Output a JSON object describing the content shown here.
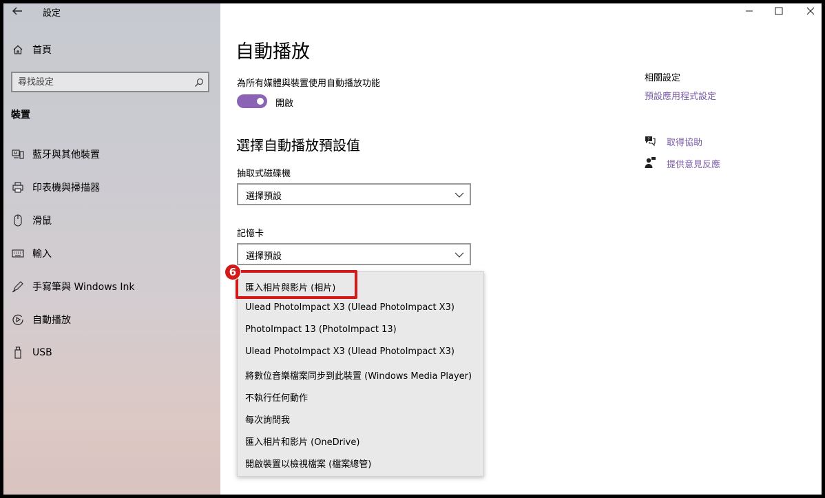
{
  "window": {
    "title": "設定",
    "controls": [
      "minimize-icon",
      "maximize-icon",
      "close-icon"
    ]
  },
  "sidebar": {
    "home_label": "首頁",
    "search_placeholder": "尋找設定",
    "section_header": "裝置",
    "items": [
      {
        "label": "藍牙與其他裝置",
        "icon": "bluetooth-devices-icon"
      },
      {
        "label": "印表機與掃描器",
        "icon": "printer-icon"
      },
      {
        "label": "滑鼠",
        "icon": "mouse-icon"
      },
      {
        "label": "輸入",
        "icon": "keyboard-icon"
      },
      {
        "label": "手寫筆與 Windows Ink",
        "icon": "pen-icon"
      },
      {
        "label": "自動播放",
        "icon": "autoplay-icon"
      },
      {
        "label": "USB",
        "icon": "usb-icon"
      }
    ]
  },
  "main": {
    "title": "自動播放",
    "toggle_label": "為所有媒體與裝置使用自動播放功能",
    "toggle_state": "開啟",
    "subheading": "選擇自動播放預設值",
    "removable_drive_label": "抽取式磁碟機",
    "removable_drive_value": "選擇預設",
    "memory_card_label": "記憶卡",
    "memory_card_value": "選擇預設",
    "dropdown_options": [
      "匯入相片與影片 (相片)",
      "Ulead PhotoImpact X3 (Ulead PhotoImpact X3)",
      "PhotoImpact 13 (PhotoImpact 13)",
      "Ulead PhotoImpact X3 (Ulead PhotoImpact X3)",
      "將數位音樂檔案同步到此裝置 (Windows Media Player)",
      "不執行任何動作",
      "每次詢問我",
      "匯入相片和影片 (OneDrive)",
      "開啟裝置以檢視檔案 (檔案總管)"
    ],
    "step_badge": "6"
  },
  "related": {
    "heading": "相關設定",
    "default_apps_link": "預設應用程式設定",
    "help_link": "取得協助",
    "feedback_link": "提供意見反應"
  },
  "colors": {
    "accent": "#8a63b5",
    "link": "#7b5ca6",
    "highlight": "#d21a1a"
  }
}
